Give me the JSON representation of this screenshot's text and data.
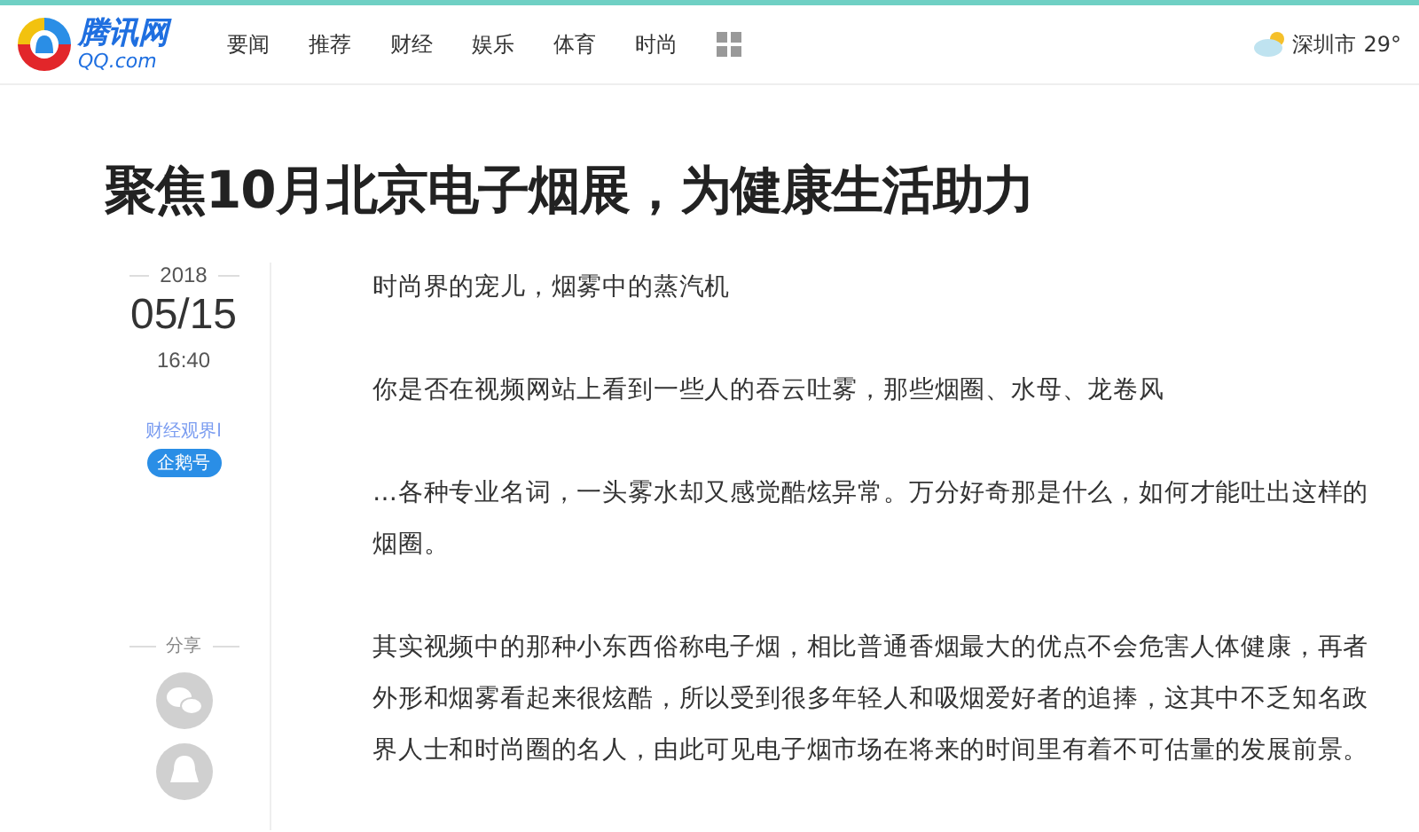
{
  "header": {
    "logo": {
      "name": "腾讯网",
      "domain": "QQ.com"
    },
    "nav": [
      {
        "label": "要闻"
      },
      {
        "label": "推荐"
      },
      {
        "label": "财经"
      },
      {
        "label": "娱乐"
      },
      {
        "label": "体育"
      },
      {
        "label": "时尚"
      }
    ],
    "weather": {
      "city": "深圳市",
      "temperature": "29°"
    }
  },
  "article": {
    "title": "聚焦10月北京电子烟展，为健康生活助力",
    "date": {
      "year": "2018",
      "day": "05/15",
      "time": "16:40"
    },
    "source": {
      "name": "财经观界l",
      "badge": "企鹅号"
    },
    "share": {
      "label": "分享"
    },
    "paragraphs": [
      "时尚界的宠儿，烟雾中的蒸汽机",
      "你是否在视频网站上看到一些人的吞云吐雾，那些烟圈、水母、龙卷风",
      "…各种专业名词，一头雾水却又感觉酷炫异常。万分好奇那是什么，如何才能吐出这样的烟圈。",
      "其实视频中的那种小东西俗称电子烟，相比普通香烟最大的优点不会危害人体健康，再者外形和烟雾看起来很炫酷，所以受到很多年轻人和吸烟爱好者的追捧，这其中不乏知名政界人士和时尚圈的名人，由此可见电子烟市场在将来的时间里有着不可估量的发展前景。"
    ]
  }
}
